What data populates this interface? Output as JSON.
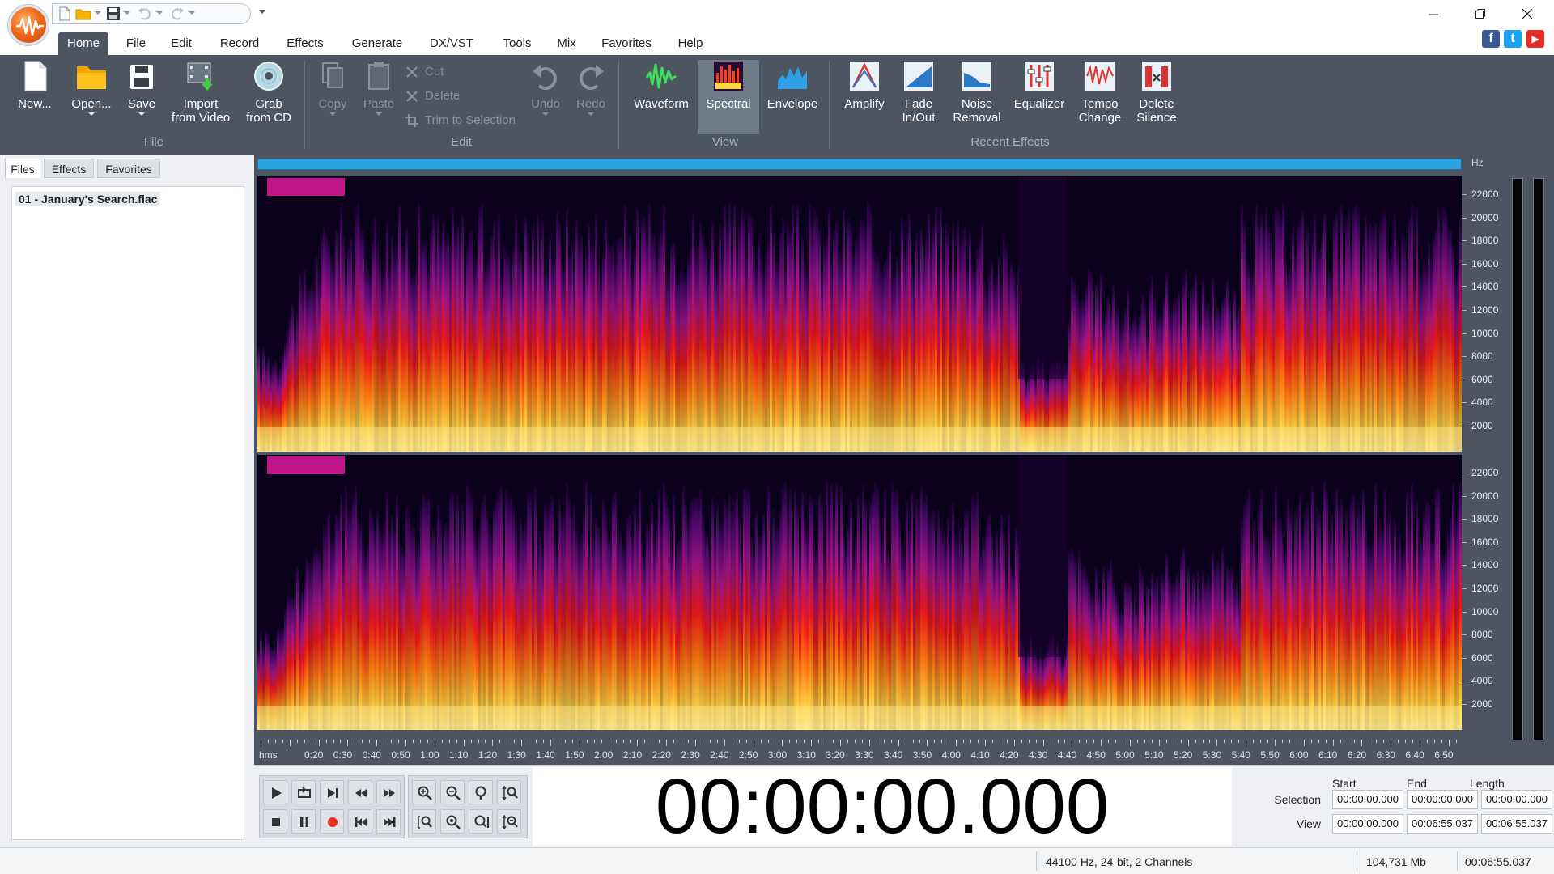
{
  "window": {
    "app_icon": "wavepad-logo-icon",
    "controls": [
      "minimize-icon",
      "restore-icon",
      "close-icon"
    ]
  },
  "quick_access": {
    "icons": [
      "new-icon",
      "open-folder-icon",
      "save-icon",
      "undo-icon",
      "redo-icon"
    ]
  },
  "menu": {
    "tabs": [
      "Home",
      "File",
      "Edit",
      "Record",
      "Effects",
      "Generate",
      "DX/VST",
      "Tools",
      "Mix",
      "Favorites",
      "Help"
    ],
    "active": "Home"
  },
  "social": [
    "facebook-icon",
    "twitter-icon",
    "youtube-icon"
  ],
  "ribbon": {
    "file": {
      "group_label": "File",
      "new": "New...",
      "open": "Open...",
      "save": "Save",
      "import_line1": "Import",
      "import_line2": "from Video",
      "grab_line1": "Grab",
      "grab_line2": "from CD"
    },
    "edit": {
      "group_label": "Edit",
      "copy": "Copy",
      "paste": "Paste",
      "cut": "Cut",
      "delete": "Delete",
      "trim": "Trim to Selection",
      "undo": "Undo",
      "redo": "Redo"
    },
    "view": {
      "group_label": "View",
      "waveform": "Waveform",
      "spectral": "Spectral",
      "envelope": "Envelope",
      "active": "Spectral"
    },
    "recent_effects": {
      "group_label": "Recent Effects",
      "amplify": "Amplify",
      "fade_line1": "Fade",
      "fade_line2": "In/Out",
      "noise_line1": "Noise",
      "noise_line2": "Removal",
      "equalizer": "Equalizer",
      "tempo_line1": "Tempo",
      "tempo_line2": "Change",
      "delete_line1": "Delete",
      "delete_line2": "Silence"
    }
  },
  "left_panel": {
    "tabs": [
      "Files",
      "Effects",
      "Favorites"
    ],
    "active_tab": "Files",
    "files": [
      "01 - January's Search.flac"
    ]
  },
  "editor": {
    "hz_unit": "Hz",
    "hz_labels": [
      "22000",
      "20000",
      "18000",
      "16000",
      "14000",
      "12000",
      "10000",
      "8000",
      "6000",
      "4000",
      "2000"
    ],
    "timeline_unit": "hms",
    "timeline_labels": [
      "0:20",
      "0:30",
      "0:40",
      "0:50",
      "1:00",
      "1:10",
      "1:20",
      "1:30",
      "1:40",
      "1:50",
      "2:00",
      "2:10",
      "2:20",
      "2:30",
      "2:40",
      "2:50",
      "3:00",
      "3:10",
      "3:20",
      "3:30",
      "3:40",
      "3:50",
      "4:00",
      "4:10",
      "4:20",
      "4:30",
      "4:40",
      "4:50",
      "5:00",
      "5:10",
      "5:20",
      "5:30",
      "5:40",
      "5:50",
      "6:00",
      "6:10",
      "6:20",
      "6:30",
      "6:40",
      "6:50"
    ],
    "channels": 2
  },
  "transport": {
    "time": "00:00:00.000",
    "row1": [
      "play-icon",
      "loop-icon",
      "play-to-end-icon",
      "rewind-icon",
      "fast-forward-icon"
    ],
    "row2": [
      "stop-icon",
      "pause-icon",
      "record-icon",
      "skip-start-icon",
      "skip-end-icon"
    ],
    "zoom_row1": [
      "zoom-in-icon",
      "zoom-out-icon",
      "zoom-100-icon",
      "zoom-vertical-icon"
    ],
    "zoom_row2": [
      "zoom-selection-icon",
      "zoom-full-icon",
      "zoom-fit-icon",
      "zoom-vertical-out-icon"
    ]
  },
  "selection": {
    "headers": {
      "start": "Start",
      "end": "End",
      "length": "Length"
    },
    "selection_label": "Selection",
    "view_label": "View",
    "selection_start": "00:00:00.000",
    "selection_end": "00:00:00.000",
    "selection_length": "00:00:00.000",
    "view_start": "00:00:00.000",
    "view_end": "00:06:55.037",
    "view_length": "00:06:55.037"
  },
  "status": {
    "format": "44100 Hz, 24-bit, 2 Channels",
    "size": "104,731 Mb",
    "duration": "00:06:55.037"
  },
  "colors": {
    "ribbon_bg": "#4d5561",
    "spectrogram_hot": "#ffe27a",
    "spectrogram_mid": "#ff2a10",
    "spectrogram_cool": "#7a1a9a",
    "overview_bar": "#2aa4e0"
  }
}
